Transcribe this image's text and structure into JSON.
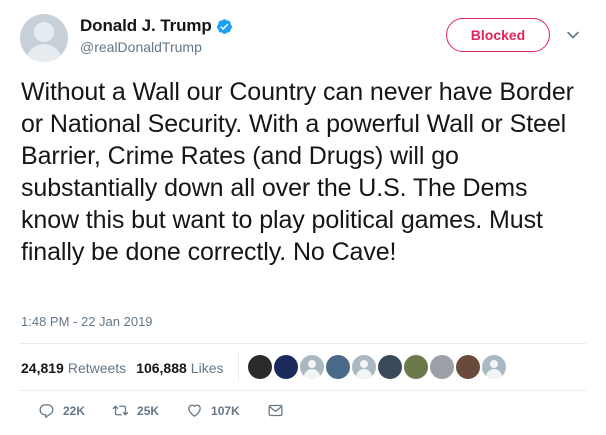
{
  "header": {
    "display_name": "Donald J. Trump",
    "handle": "@realDonaldTrump",
    "blocked_label": "Blocked",
    "brand_color": "#1da1f2",
    "blocked_color": "#e0245e"
  },
  "tweet": {
    "text": "Without a Wall our Country can never have Border or National Security. With a powerful Wall or Steel Barrier, Crime Rates (and Drugs) will go substantially down all over the U.S. The Dems know this but want to play political games. Must finally be done correctly. No Cave!",
    "timestamp": "1:48 PM - 22 Jan 2019"
  },
  "stats": {
    "retweets_count": "24,819",
    "retweets_label": "Retweets",
    "likes_count": "106,888",
    "likes_label": "Likes",
    "liker_avatar_colors": [
      "#2b2b2b",
      "#1a2a5a",
      "#aab8c2",
      "#4a6a8a",
      "#aab8c2",
      "#3a4a5a",
      "#6a7a4a",
      "#9aa0a6",
      "#6a4a3a",
      "#aab8c2"
    ]
  },
  "actions": {
    "reply_count": "22K",
    "retweet_count": "25K",
    "like_count": "107K",
    "icons": [
      "reply-icon",
      "retweet-icon",
      "like-icon",
      "direct-message-icon"
    ]
  }
}
